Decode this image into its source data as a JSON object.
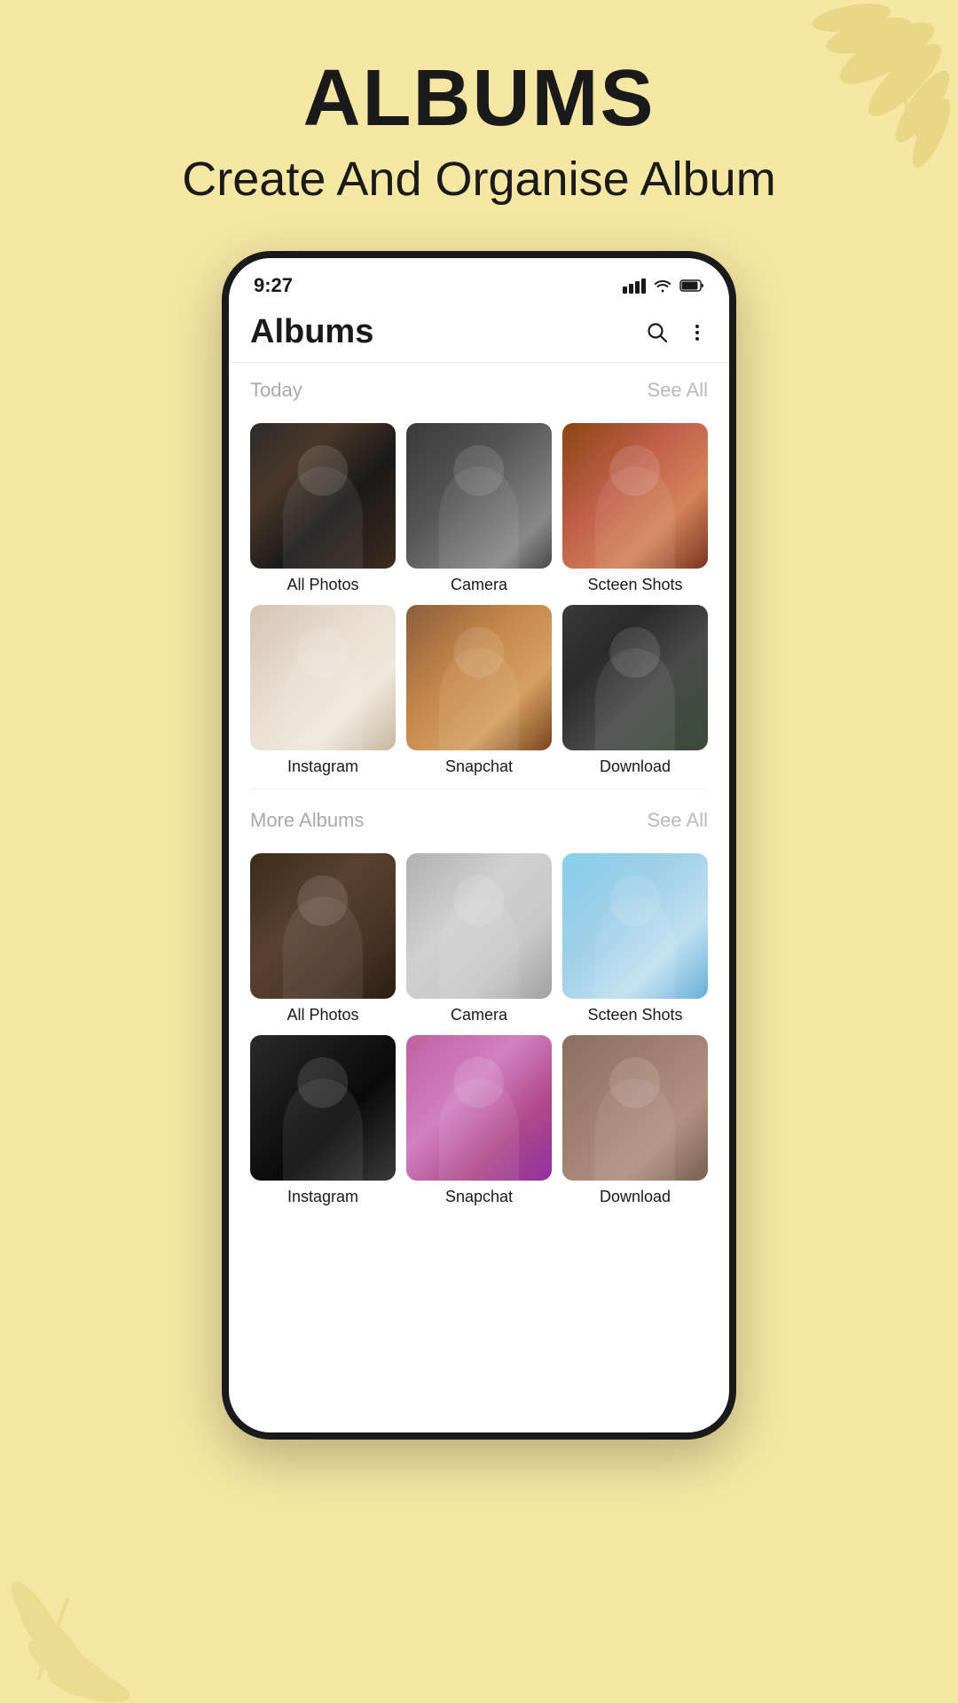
{
  "background": {
    "color": "#f5e6a3"
  },
  "page_header": {
    "title": "ALBUMS",
    "subtitle": "Create And Organise Album"
  },
  "phone": {
    "status_bar": {
      "time": "9:27"
    },
    "app_header": {
      "title": "Albums",
      "search_icon": "search-icon",
      "menu_icon": "more-vert-icon"
    },
    "today_section": {
      "title": "Today",
      "see_all_label": "See All",
      "albums": [
        {
          "name": "All Photos",
          "thumb_class": "thumb-1"
        },
        {
          "name": "Camera",
          "thumb_class": "thumb-2"
        },
        {
          "name": "Scteen Shots",
          "thumb_class": "thumb-3"
        },
        {
          "name": "Instagram",
          "thumb_class": "thumb-4"
        },
        {
          "name": "Snapchat",
          "thumb_class": "thumb-5"
        },
        {
          "name": "Download",
          "thumb_class": "thumb-6"
        }
      ]
    },
    "more_albums_section": {
      "title": "More Albums",
      "see_all_label": "See All",
      "albums": [
        {
          "name": "All Photos",
          "thumb_class": "thumb-7"
        },
        {
          "name": "Camera",
          "thumb_class": "thumb-8"
        },
        {
          "name": "Scteen Shots",
          "thumb_class": "thumb-9"
        },
        {
          "name": "Instagram",
          "thumb_class": "thumb-10"
        },
        {
          "name": "Snapchat",
          "thumb_class": "thumb-11"
        },
        {
          "name": "Download",
          "thumb_class": "thumb-12"
        }
      ]
    }
  }
}
